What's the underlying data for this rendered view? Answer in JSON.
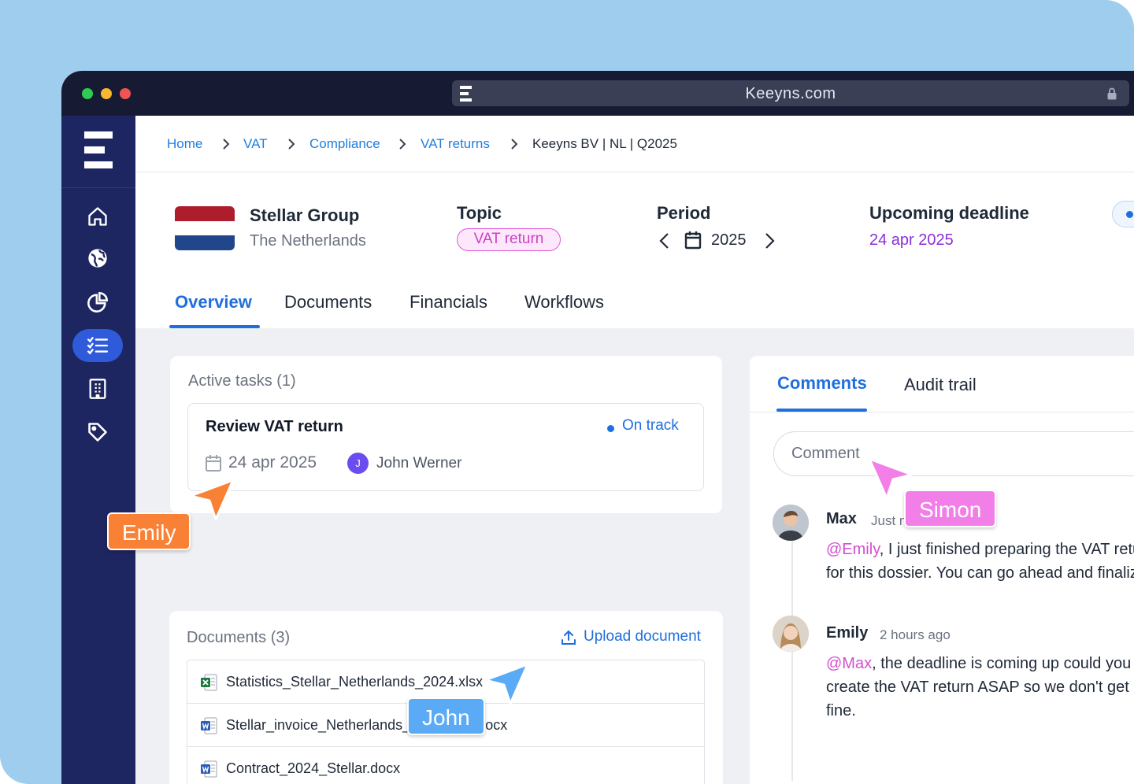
{
  "browser": {
    "url": "Keeyns.com"
  },
  "breadcrumb": {
    "items": [
      "Home",
      "VAT",
      "Compliance",
      "VAT returns"
    ],
    "current": "Keeyns BV | NL | Q2025"
  },
  "entity": {
    "name": "Stellar Group",
    "country": "The Netherlands"
  },
  "topic": {
    "label": "Topic",
    "value": "VAT return"
  },
  "period": {
    "label": "Period",
    "value": "2025"
  },
  "deadline": {
    "label": "Upcoming deadline",
    "value": "24 apr 2025"
  },
  "tabs": [
    "Overview",
    "Documents",
    "Financials",
    "Workflows"
  ],
  "tasks": {
    "title": "Active tasks (1)",
    "items": [
      {
        "name": "Review VAT return",
        "status": "On track",
        "date": "24 apr 2025",
        "assignee_initial": "J",
        "assignee": "John Werner"
      }
    ]
  },
  "documents": {
    "title": "Documents (3)",
    "upload_label": "Upload document",
    "files": [
      {
        "name": "Statistics_Stellar_Netherlands_2024.xlsx",
        "type": "excel"
      },
      {
        "name": "Stellar_invoice_Netherlands_20250502.docx",
        "type": "word"
      },
      {
        "name": "Contract_2024_Stellar.docx",
        "type": "word"
      }
    ]
  },
  "comments_panel": {
    "tabs": [
      "Comments",
      "Audit trail"
    ],
    "input_placeholder": "Comment",
    "comments": [
      {
        "author": "Max",
        "time": "Just now",
        "mention": "@Emily",
        "line1": ", I just finished preparing the VAT return",
        "line2": "for this dossier. You can go ahead and finalize it."
      },
      {
        "author": "Emily",
        "time": "2 hours ago",
        "mention": "@Max",
        "line1": ", the deadline is coming up could you",
        "line2": "create the VAT return ASAP so we don't get a",
        "line3": "fine."
      }
    ]
  },
  "cursors": [
    {
      "name": "Emily",
      "color": "#f98135"
    },
    {
      "name": "Simon",
      "color": "#f27ee8"
    },
    {
      "name": "John",
      "color": "#5aaaf6"
    }
  ],
  "colors": {
    "accent": "#1f6fdc",
    "sidebar": "#1d2660",
    "mention": "#d24fd0",
    "deadline": "#8b2fd9"
  }
}
